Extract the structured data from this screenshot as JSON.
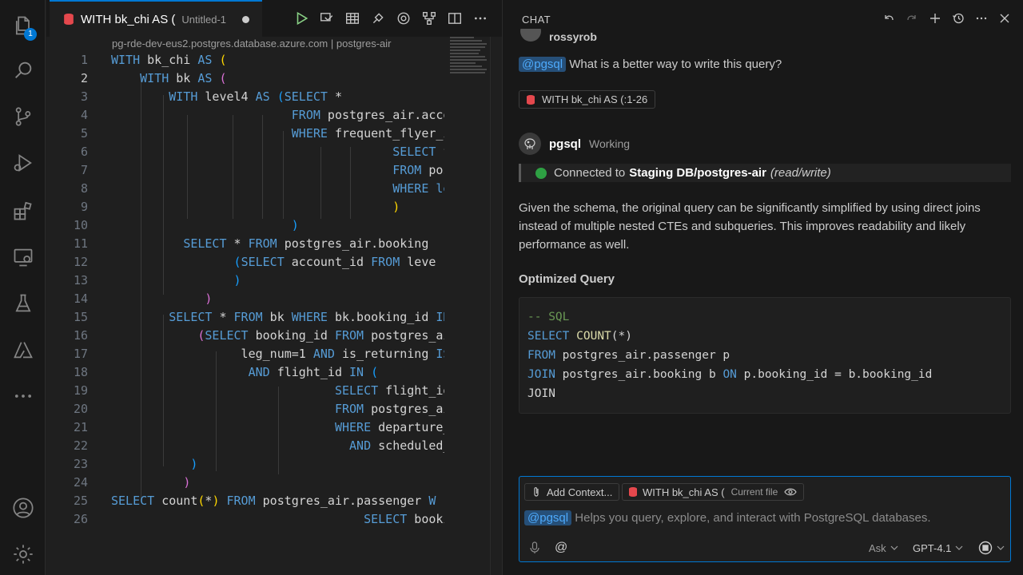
{
  "activity": {
    "badge": "1"
  },
  "editor": {
    "tab_title": "WITH bk_chi AS (",
    "tab_sub": "Untitled-1",
    "breadcrumb": "pg-rde-dev-eus2.postgres.database.azure.com | postgres-air",
    "active_line": 2,
    "lines": [
      {
        "n": "1"
      },
      {
        "n": "2"
      },
      {
        "n": "3"
      },
      {
        "n": "4"
      },
      {
        "n": "5"
      },
      {
        "n": "6"
      },
      {
        "n": "7"
      },
      {
        "n": "8"
      },
      {
        "n": "9"
      },
      {
        "n": "10"
      },
      {
        "n": "11"
      },
      {
        "n": "12"
      },
      {
        "n": "13"
      },
      {
        "n": "14"
      },
      {
        "n": "15"
      },
      {
        "n": "16"
      },
      {
        "n": "17"
      },
      {
        "n": "18"
      },
      {
        "n": "19"
      },
      {
        "n": "20"
      },
      {
        "n": "21"
      },
      {
        "n": "22"
      },
      {
        "n": "23"
      },
      {
        "n": "24"
      },
      {
        "n": "25"
      },
      {
        "n": "26"
      }
    ]
  },
  "chat": {
    "title": "CHAT",
    "user_name": "rossyrob",
    "question_mention": "@pgsql",
    "question_text": "What is a better way to write this query?",
    "reference": "WITH bk_chi AS (:1-26",
    "bot_name": "pgsql",
    "bot_status": "Working",
    "conn_prefix": "Connected to",
    "conn_db": "Staging DB/postgres-air",
    "conn_mode": "(read/write)",
    "paragraph": "Given the schema, the original query can be significantly simplified by using direct joins instead of multiple nested CTEs and subqueries. This improves readability and likely performance as well.",
    "heading": "Optimized Query",
    "code": {
      "comment": "-- SQL",
      "l2_kw": "SELECT",
      "l2_fn": "COUNT",
      "l2_rest": "(*)",
      "l3_kw": "FROM",
      "l3_rest": " postgres_air.passenger p",
      "l4_kw": "JOIN",
      "l4_a": " postgres_air.booking b ",
      "l4_on": "ON",
      "l4_b": " p.booking_id = b.booking_id",
      "l5_kw": "JOIN"
    },
    "input": {
      "add_context": "Add Context...",
      "file_chip": "WITH bk_chi AS (",
      "file_chip_sub": "Current file",
      "mention": "@pgsql",
      "placeholder": "Helps you query, explore, and interact with PostgreSQL databases.",
      "at": "@",
      "mode": "Ask",
      "model": "GPT-4.1"
    }
  },
  "colors": {
    "accent": "#0078d4",
    "connected": "#2ea043",
    "keyword": "#569cd6"
  }
}
